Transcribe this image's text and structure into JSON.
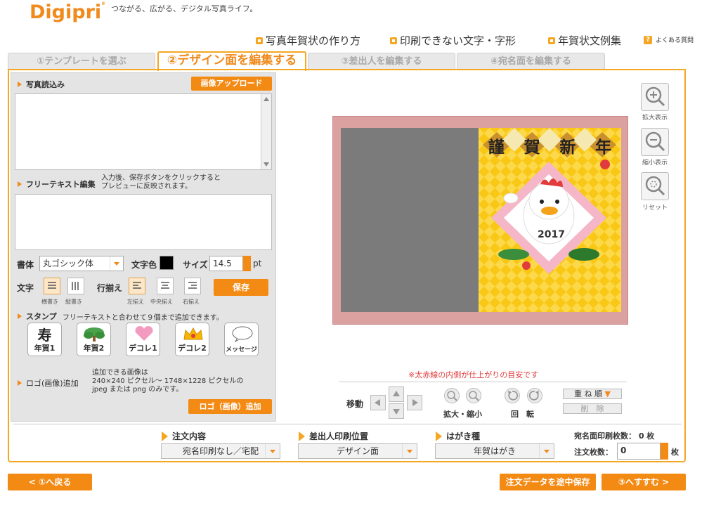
{
  "header": {
    "logo": "Digipri",
    "logo_mark": "®",
    "tagline": "つながる、広がる、デジタル写真ライフ。",
    "links": [
      "写真年賀状の作り方",
      "印刷できない文字・字形",
      "年賀状文例集"
    ],
    "faq": "よくある質問"
  },
  "tabs": [
    "①テンプレートを選ぶ",
    "②デザイン面を編集する",
    "③差出人を編集する",
    "④宛名面を編集する"
  ],
  "left": {
    "photo_title": "写真読込み",
    "upload_button": "画像アップロード",
    "freetext_title": "フリーテキスト編集",
    "freetext_note1": "入力後、保存ボタンをクリックすると",
    "freetext_note2": "プレビューに反映されます。",
    "font_label": "書体",
    "font_value": "丸ゴシック体",
    "color_label": "文字色",
    "size_label": "サイズ",
    "size_value": "14.5",
    "size_unit": "pt",
    "text_label": "文字",
    "horizontal": "横書き",
    "vertical": "縦書き",
    "align_label": "行揃え",
    "align_left": "左揃え",
    "align_center": "中央揃え",
    "align_right": "右揃え",
    "save_button": "保存",
    "stamp_title": "スタンプ",
    "stamp_note": "フリーテキストと合わせて９個まで追加できます。",
    "stamps": [
      "年賀1",
      "年賀2",
      "デコレ1",
      "デコレ2",
      "メッセージ"
    ],
    "logo_title": "ロゴ(画像)追加",
    "logo_note1": "追加できる画像は",
    "logo_note2": "240×240 ピクセル～ 1748×1228 ピクセルの",
    "logo_note3": "jpeg または png のみです。",
    "logo_button": "ロゴ（画像）追加"
  },
  "preview": {
    "title_chars": [
      "謹",
      "賀",
      "新",
      "年"
    ],
    "year": "2017",
    "notice": "※太赤線の内側が仕上がりの目安です",
    "move_label": "移動",
    "zoom_label": "拡大・縮小",
    "rotate_label": "回　転",
    "order_button": "重 ね 順",
    "delete_button": "削　除"
  },
  "tools": [
    "拡大表示",
    "縮小表示",
    "リセット"
  ],
  "bottom": {
    "order_label": "注文内容",
    "order_value": "宛名印刷なし／宅配",
    "sender_label": "差出人印刷位置",
    "sender_value": "デザイン面",
    "card_label": "はがき種",
    "card_value": "年賀はがき",
    "addr_count": "宛名面印刷枚数： 0 枚",
    "qty_label": "注文枚数：",
    "qty_value": "0",
    "qty_unit": "枚"
  },
  "nav": {
    "back": "< ①へ戻る",
    "save_progress": "注文データを途中保存",
    "next": "③へすすむ >"
  },
  "colors": {
    "accent": "#f38a14",
    "frame": "#f5a623",
    "card_border": "#d99a9a",
    "card_yellow": "#f9c816",
    "photo_gray": "#7a7a7a"
  }
}
